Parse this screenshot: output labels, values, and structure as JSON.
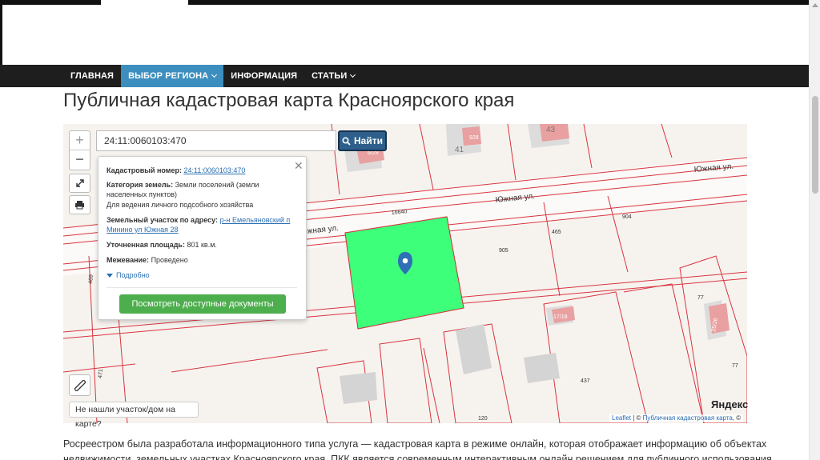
{
  "nav": {
    "items": [
      {
        "label": "ГЛАВНАЯ"
      },
      {
        "label": "ВЫБОР РЕГИОНА",
        "dropdown": true,
        "active": true
      },
      {
        "label": "ИНФОРМАЦИЯ"
      },
      {
        "label": "СТАТЬИ",
        "dropdown": true
      }
    ]
  },
  "page": {
    "title": "Публичная кадастровая карта Красноярского края",
    "text": "Росреестром была разработала информационного типа услуга — кадастровая карта в режиме онлайн, которая отображает информацию об объектах недвижимости, земельных участках Красноярского края. ПКК является современным интерактивным онлайн решением для публичного использования"
  },
  "map": {
    "search": {
      "value": "24:11:0060103:470",
      "button": "Найти"
    },
    "zoom_in": "+",
    "zoom_out": "−",
    "popup": {
      "cadastral_label": "Кадастровый номер:",
      "cadastral_value": "24:11:0060103:470",
      "category_label": "Категория земель:",
      "category_value": "Земли поселений (земли населенных пунктов)",
      "usage": "Для ведения личного подсобного хозяйства",
      "address_label": "Земельный участок по адресу:",
      "address_value": "р-н Емельяновский п Минино ул Южная 28",
      "area_label": "Уточненная площадь:",
      "area_value": "801 кв.м.",
      "survey_label": "Межевание:",
      "survey_value": "Проведено",
      "more": "Подробно",
      "docs_button": "Посмотреть доступные документы"
    },
    "not_found": "Не нашли участок/дом на карте?",
    "labels": {
      "street1": "Южная ул.",
      "street2": "Южная ул.",
      "street3": "Южная ул.",
      "p16640": "16640",
      "p904": "904",
      "p905": "905",
      "p465": "465",
      "p77a": "77",
      "p77b": "77",
      "p437": "437",
      "p120": "120",
      "p928": "928",
      "p41": "41",
      "p43": "43",
      "p469": "469",
      "p471": "471",
      "pA": "6/29",
      "pB": "17/18",
      "pC": "25/26"
    },
    "attribution": {
      "leaflet": "Leaflet",
      "sep": " | © ",
      "pkk": "Публичная кадастровая карта",
      "tail": ", ©"
    },
    "yandex": "Яндекс",
    "colors": {
      "selected_parcel": "#3dff7a",
      "parcel_border": "#d9343f",
      "building": "#e8a0a0",
      "marker": "#2e6fb6"
    }
  }
}
